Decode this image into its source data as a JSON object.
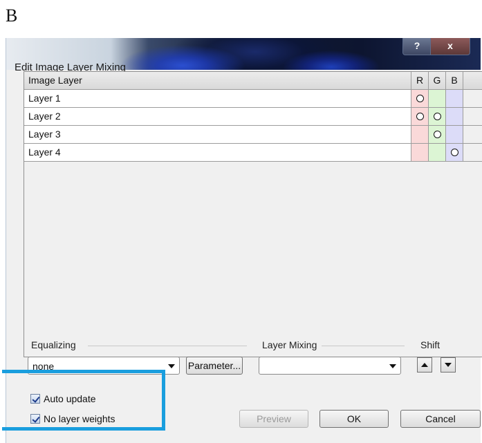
{
  "figure_label": "B",
  "dialog": {
    "title": "Edit Image Layer Mixing",
    "help_label": "?",
    "close_label": "x"
  },
  "table": {
    "headers": {
      "name": "Image Layer",
      "r": "R",
      "g": "G",
      "b": "B"
    },
    "rows": [
      {
        "name": "Layer 1",
        "r": true,
        "g": false,
        "b": false
      },
      {
        "name": "Layer 2",
        "r": true,
        "g": true,
        "b": false
      },
      {
        "name": "Layer 3",
        "r": false,
        "g": true,
        "b": false
      },
      {
        "name": "Layer 4",
        "r": false,
        "g": false,
        "b": true
      }
    ]
  },
  "equalizing": {
    "label": "Equalizing",
    "value": "none",
    "parameter_button": "Parameter..."
  },
  "layer_mixing": {
    "label": "Layer Mixing",
    "value": ""
  },
  "shift": {
    "label": "Shift"
  },
  "options": {
    "auto_update": {
      "label": "Auto update",
      "checked": true
    },
    "no_layer_weights": {
      "label": "No layer weights",
      "checked": true
    }
  },
  "buttons": {
    "preview": "Preview",
    "ok": "OK",
    "cancel": "Cancel"
  },
  "colors": {
    "highlight": "#1a9ede",
    "r_column": "#fad9d9",
    "g_column": "#dcf5d4",
    "b_column": "#dcdcf8"
  }
}
